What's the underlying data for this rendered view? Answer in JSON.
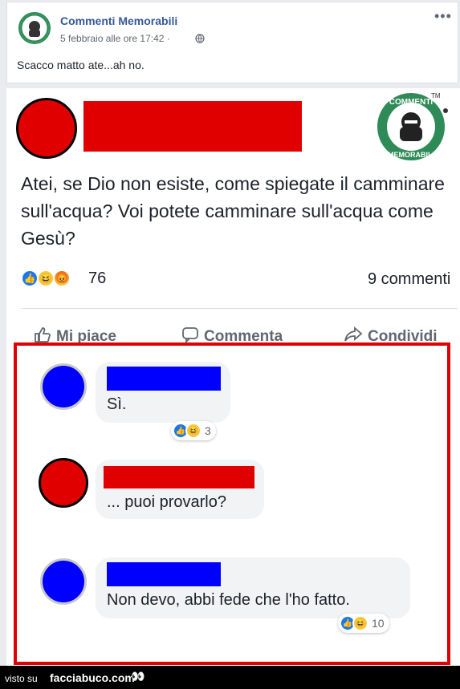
{
  "post": {
    "page_name": "Commenti Memorabili",
    "time": "5 febbraio alle ore 17:42 ·",
    "caption": "Scacco matto ate...ah no.",
    "more_label": "•••"
  },
  "screenshot": {
    "logo_text_top": "COMMENTI",
    "logo_text_bottom": "MEMORABILI",
    "tm": "TM",
    "op_text": "Atei, se Dio non esiste, come spiegate il camminare sull'acqua? Voi potete camminare sull'acqua come Gesù?",
    "reaction_count": "76",
    "comment_count": "9 commenti",
    "actions": {
      "like": "Mi piace",
      "comment": "Commenta",
      "share": "Condividi"
    },
    "comments": [
      {
        "text": "Sì.",
        "reactions": "3"
      },
      {
        "text": "... puoi provarlo?"
      },
      {
        "text": "Non devo, abbi fede che l'ho fatto.",
        "reactions": "10"
      }
    ]
  },
  "footer": {
    "prefix": "visto su",
    "brand": "facciabuco.com",
    "eyes": "👀"
  },
  "colors": {
    "redaction_red": "#e00000",
    "redaction_blue": "#0000ff",
    "link_blue": "#365899",
    "logo_green": "#2e8b57"
  }
}
